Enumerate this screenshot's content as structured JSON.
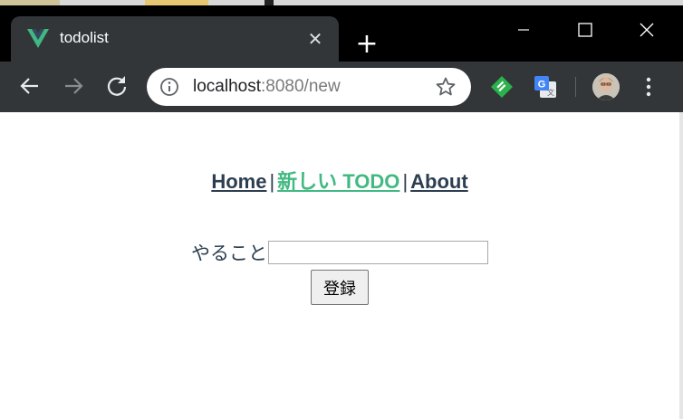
{
  "browser": {
    "tab": {
      "title": "todolist",
      "close_glyph": "✕",
      "favicon": "vue-logo-icon"
    },
    "new_tab_glyph": "+",
    "window_controls": [
      "minimize-icon",
      "maximize-icon",
      "close-icon"
    ],
    "url": {
      "host": "localhost",
      "path": ":8080/new"
    },
    "extensions": [
      "feedly-icon",
      "google-translate-icon"
    ],
    "colors": {
      "titlebar": "#000000",
      "toolbar": "#323639",
      "omnibox": "#ffffff"
    }
  },
  "page": {
    "nav": {
      "home": "Home",
      "new_todo": "新しい TODO",
      "about": "About",
      "separator": "|",
      "active_color": "#42b983",
      "text_color": "#2c3e50"
    },
    "form": {
      "label": "やること",
      "input_value": "",
      "submit_label": "登録"
    }
  }
}
